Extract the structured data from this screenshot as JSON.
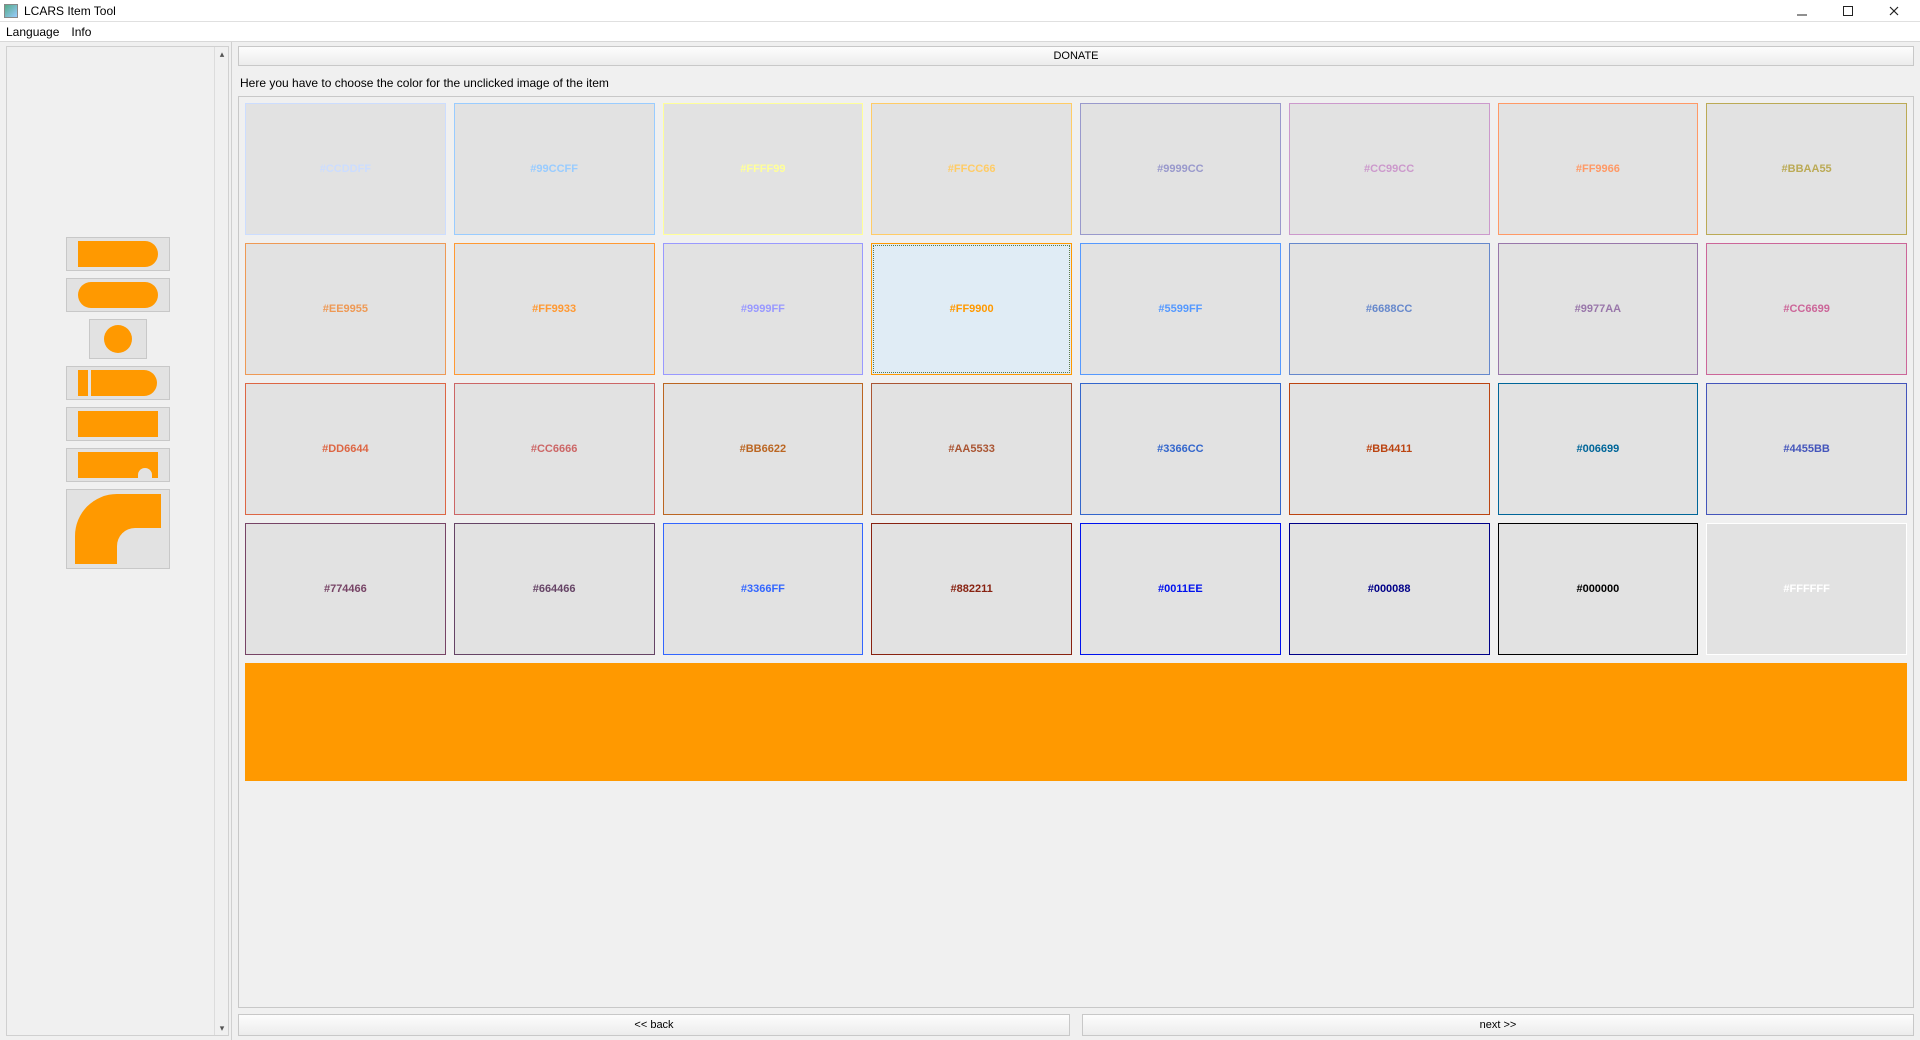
{
  "window": {
    "title": "LCARS Item Tool"
  },
  "menu": {
    "language": "Language",
    "info": "Info"
  },
  "main": {
    "donate": "DONATE",
    "instruction": "Here you have to choose the color for the unclicked image of the item",
    "back": "<< back",
    "next": "next >>",
    "preview_color": "#FF9900",
    "selected_index": 11
  },
  "colors": [
    "#CCDDFF",
    "#99CCFF",
    "#FFFF99",
    "#FFCC66",
    "#9999CC",
    "#CC99CC",
    "#FF9966",
    "#BBAA55",
    "#EE9955",
    "#FF9933",
    "#9999FF",
    "#FF9900",
    "#5599FF",
    "#6688CC",
    "#9977AA",
    "#CC6699",
    "#DD6644",
    "#CC6666",
    "#BB6622",
    "#AA5533",
    "#3366CC",
    "#BB4411",
    "#006699",
    "#4455BB",
    "#774466",
    "#664466",
    "#3366FF",
    "#882211",
    "#0011EE",
    "#000088",
    "#000000",
    "#FFFFFF"
  ]
}
